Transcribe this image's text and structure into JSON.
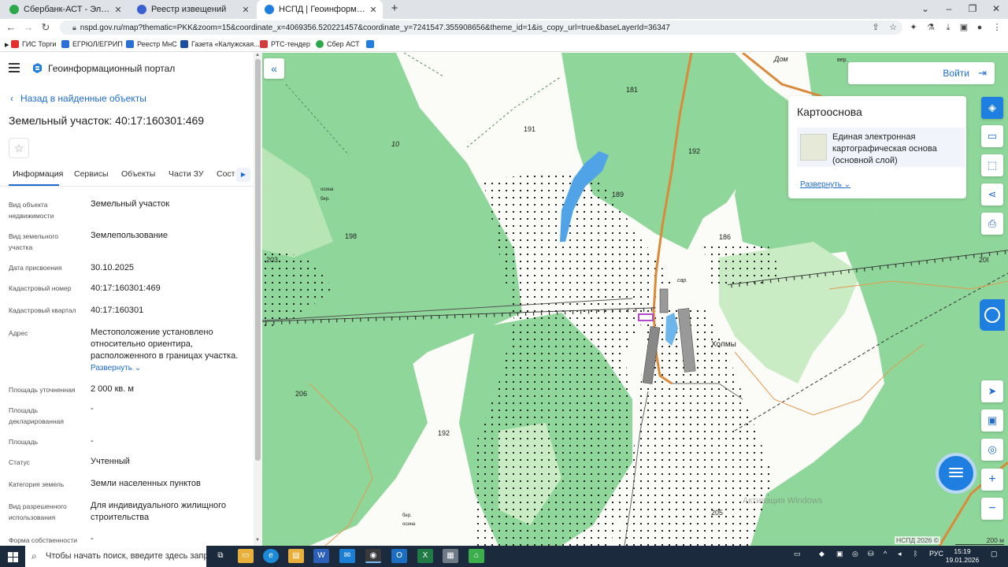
{
  "browser": {
    "tabs": [
      {
        "label": "Сбербанк-АСТ - Электронная т",
        "active": false,
        "favicon_color": "#2ca84b"
      },
      {
        "label": "Реестр извещений",
        "active": false,
        "favicon_color": "#3a5fd0"
      },
      {
        "label": "НСПД | Геоинформационный п",
        "active": true,
        "favicon_color": "#1e7fe0"
      }
    ],
    "new_tab": "+",
    "url": "nspd.gov.ru/map?thematic=PKK&zoom=15&coordinate_x=4069356.520221457&coordinate_y=7241547.355908656&theme_id=1&is_copy_url=true&baseLayerId=36347",
    "bookmarks": [
      {
        "label": "ГИС Торги",
        "color": "#e0322a"
      },
      {
        "label": "ЕГРЮЛ/ЕГРИП",
        "color": "#2a6fd6"
      },
      {
        "label": "Реестр МнС",
        "color": "#2a6fd6"
      },
      {
        "label": "Газета «Калужская...",
        "color": "#1a4ea0"
      },
      {
        "label": "РТС-тендер",
        "color": "#d23c3c"
      },
      {
        "label": "Сбер АСТ",
        "color": "#2ca84b"
      }
    ]
  },
  "panel": {
    "portal_title": "Геоинформационный портал",
    "back_link": "Назад в найденные объекты",
    "title": "Земельный участок: 40:17:160301:469",
    "tabs": [
      "Информация",
      "Сервисы",
      "Объекты",
      "Части ЗУ",
      "Соста"
    ],
    "fields": [
      {
        "label": "Вид объекта недвижимости",
        "value": "Земельный участок"
      },
      {
        "label": "Вид земельного участка",
        "value": "Землепользование"
      },
      {
        "label": "Дата присвоения",
        "value": "30.10.2025"
      },
      {
        "label": "Кадастровый номер",
        "value": "40:17:160301:469"
      },
      {
        "label": "Кадастровый квартал",
        "value": "40:17:160301"
      },
      {
        "label": "Адрес",
        "value": "Местоположение установлено относительно ориентира, расположенного в границах участка."
      },
      {
        "label": "Площадь уточненная",
        "value": "2 000 кв. м"
      },
      {
        "label": "Площадь декларированная",
        "value": "-"
      },
      {
        "label": "Площадь",
        "value": "-"
      },
      {
        "label": "Статус",
        "value": "Учтенный"
      },
      {
        "label": "Категория земель",
        "value": "Земли населенных пунктов"
      },
      {
        "label": "Вид разрешенного использования",
        "value": "Для индивидуального жилищного строительства"
      },
      {
        "label": "Форма собственности",
        "value": "-"
      }
    ],
    "expand_label": "Развернуть"
  },
  "map": {
    "labels": [
      "Дом",
      "вер.",
      "181",
      "191",
      "192",
      "189",
      "10",
      "осина",
      "бер.",
      "198",
      "203",
      "186",
      "сар.",
      "Холмы",
      "20I",
      "206",
      "192",
      "бер.",
      "осина",
      "205"
    ],
    "login_label": "Войти",
    "basemap": {
      "title": "Картооснова",
      "item": "Единая электронная картографическая основа (основной слой)",
      "expand": "Развернуть"
    },
    "watermark": "Активация Windows",
    "copyright": "НСПД 2026 ©",
    "scale": "200 м",
    "colors": {
      "forest": "#8fd69a",
      "light_forest": "#c9ecc4",
      "water": "#4fa3e6",
      "road": "#d98a3a",
      "parcel": "#b44ac9"
    }
  },
  "taskbar": {
    "search_placeholder": "Чтобы начать поиск, введите здесь запрос",
    "lang": "РУС",
    "time": "15:19",
    "date": "19.01.2026"
  }
}
